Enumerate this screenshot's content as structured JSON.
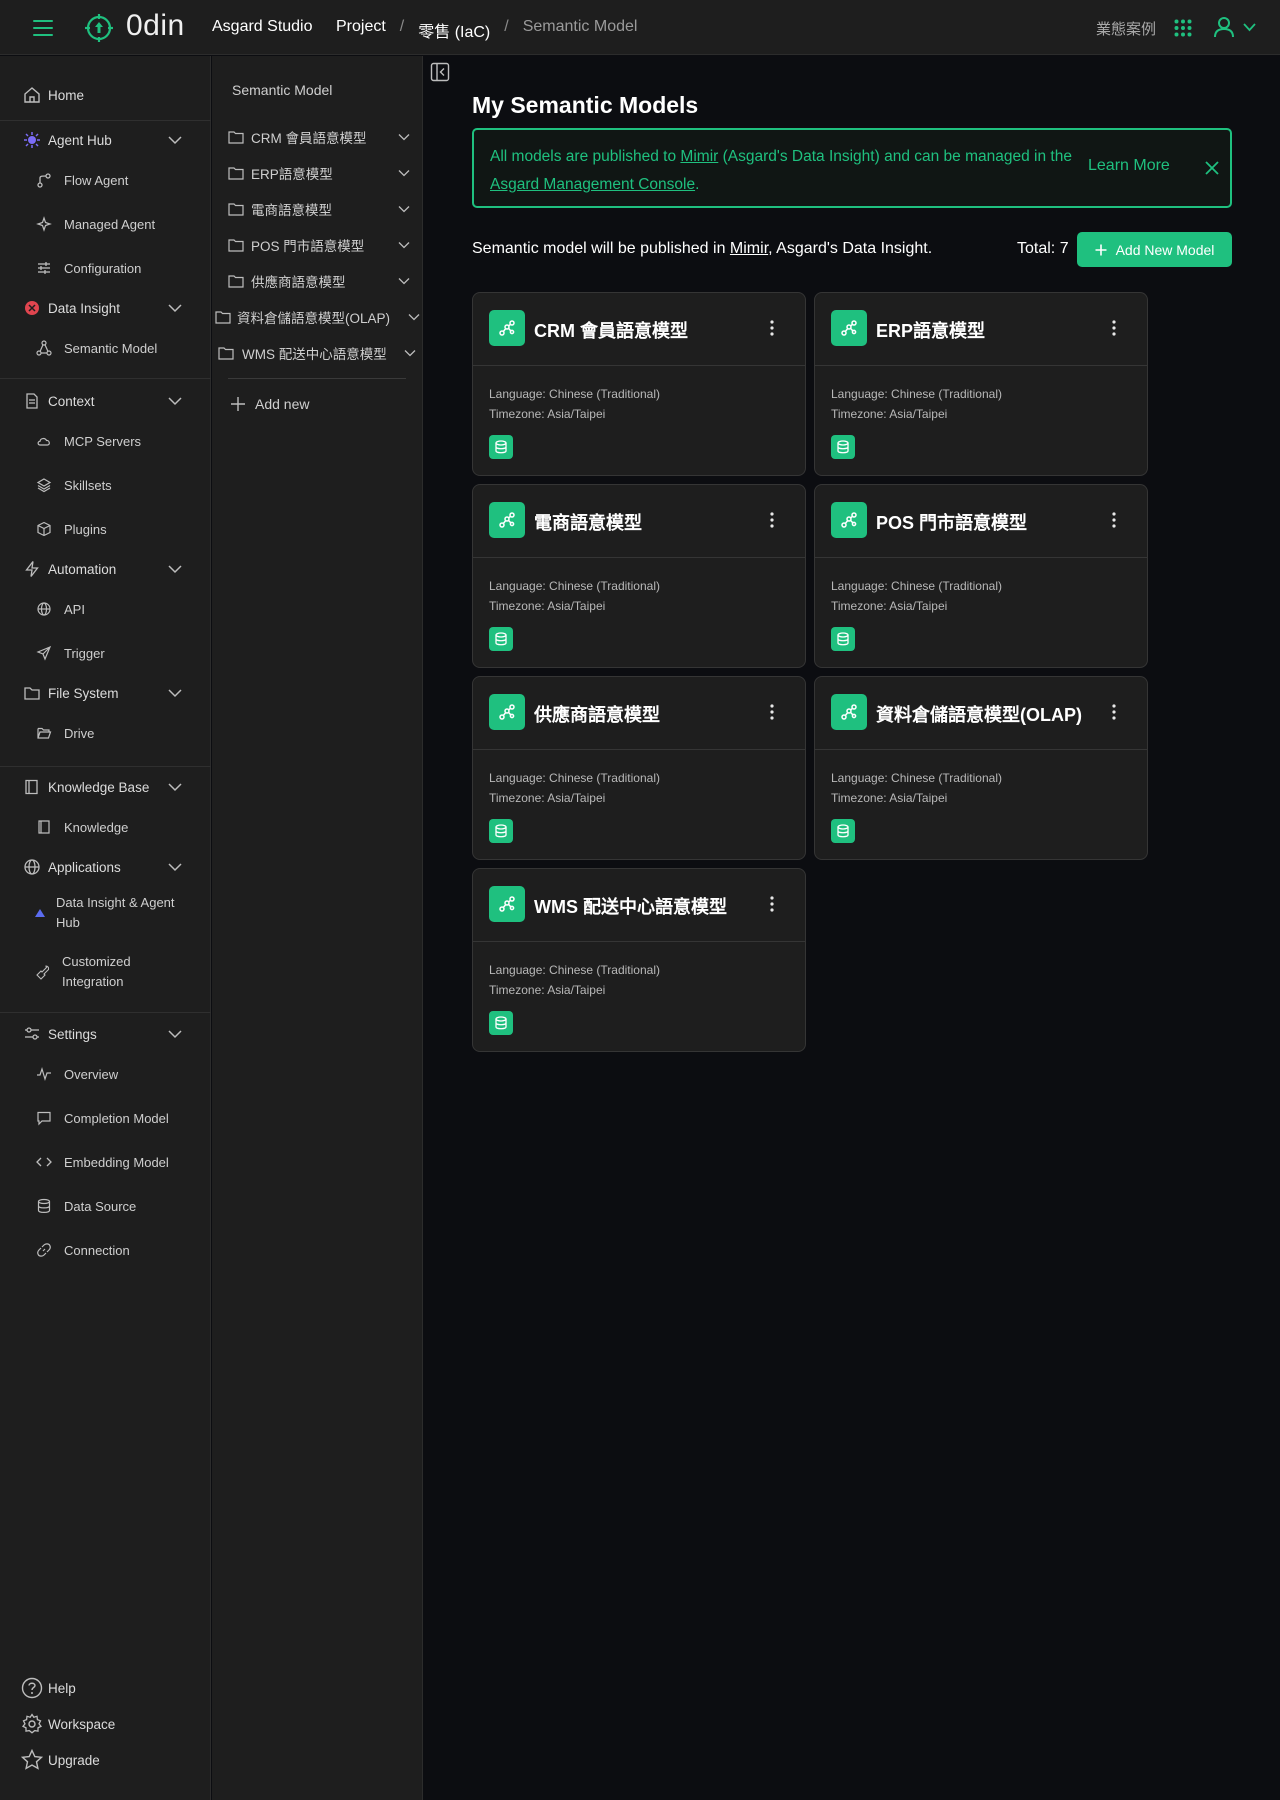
{
  "topbar": {
    "brand": "0din",
    "studio": "Asgard Studio",
    "breadcrumb": {
      "project": "Project",
      "project_name": "零售 (IaC)",
      "current": "Semantic Model",
      "separator": "/"
    },
    "business_case": "業態案例"
  },
  "sidebar": {
    "home": "Home",
    "agent_hub": {
      "label": "Agent Hub",
      "items": [
        "Flow Agent",
        "Managed Agent",
        "Configuration"
      ]
    },
    "data_insight": {
      "label": "Data Insight",
      "items": [
        "Semantic Model"
      ]
    },
    "context": {
      "label": "Context",
      "items": [
        "MCP Servers",
        "Skillsets",
        "Plugins"
      ]
    },
    "automation": {
      "label": "Automation",
      "items": [
        "API",
        "Trigger"
      ]
    },
    "file_system": {
      "label": "File System",
      "items": [
        "Drive"
      ]
    },
    "knowledge_base": {
      "label": "Knowledge Base",
      "items": [
        "Knowledge"
      ]
    },
    "applications": {
      "label": "Applications",
      "items": [
        [
          "Data Insight & Agent",
          "Hub"
        ],
        [
          "Customized",
          "Integration"
        ]
      ]
    },
    "settings": {
      "label": "Settings",
      "items": [
        "Overview",
        "Completion Model",
        "Embedding Model",
        "Data Source",
        "Connection"
      ]
    },
    "footer": [
      "Help",
      "Workspace",
      "Upgrade"
    ]
  },
  "tree": {
    "title": "Semantic Model",
    "items": [
      "CRM 會員語意模型",
      "ERP語意模型",
      "電商語意模型",
      "POS 門市語意模型",
      "供應商語意模型",
      "資料倉儲語意模型(OLAP)",
      "WMS 配送中心語意模型"
    ],
    "add_new": "Add new"
  },
  "main": {
    "title": "My Semantic Models",
    "banner": {
      "text1": "All models are published to ",
      "link1": "Mimir",
      "text2": " (Asgard's Data Insight) and can be managed in the ",
      "link2": "Asgard Management Console",
      "text3": ".",
      "learn_more": "Learn More"
    },
    "publish": {
      "text1": "Semantic model will be published in ",
      "link": "Mimir",
      "text2": ", Asgard's Data Insight."
    },
    "total": "Total: 7",
    "add_button": "Add New Model",
    "cards": [
      {
        "title": "CRM 會員語意模型",
        "language": "Language: Chinese (Traditional)",
        "timezone": "Timezone: Asia/Taipei"
      },
      {
        "title": "ERP語意模型",
        "language": "Language: Chinese (Traditional)",
        "timezone": "Timezone: Asia/Taipei"
      },
      {
        "title": "電商語意模型",
        "language": "Language: Chinese (Traditional)",
        "timezone": "Timezone: Asia/Taipei"
      },
      {
        "title": "POS 門市語意模型",
        "language": "Language: Chinese (Traditional)",
        "timezone": "Timezone: Asia/Taipei"
      },
      {
        "title": "供應商語意模型",
        "language": "Language: Chinese (Traditional)",
        "timezone": "Timezone: Asia/Taipei"
      },
      {
        "title": "資料倉儲語意模型(OLAP)",
        "language": "Language: Chinese (Traditional)",
        "timezone": "Timezone: Asia/Taipei"
      },
      {
        "title": "WMS 配送中心語意模型",
        "language": "Language: Chinese (Traditional)",
        "timezone": "Timezone: Asia/Taipei"
      }
    ]
  },
  "colors": {
    "accent": "#1fc07f",
    "panel": "#1e1e1e",
    "background": "#0c0d11",
    "border": "#353535"
  }
}
